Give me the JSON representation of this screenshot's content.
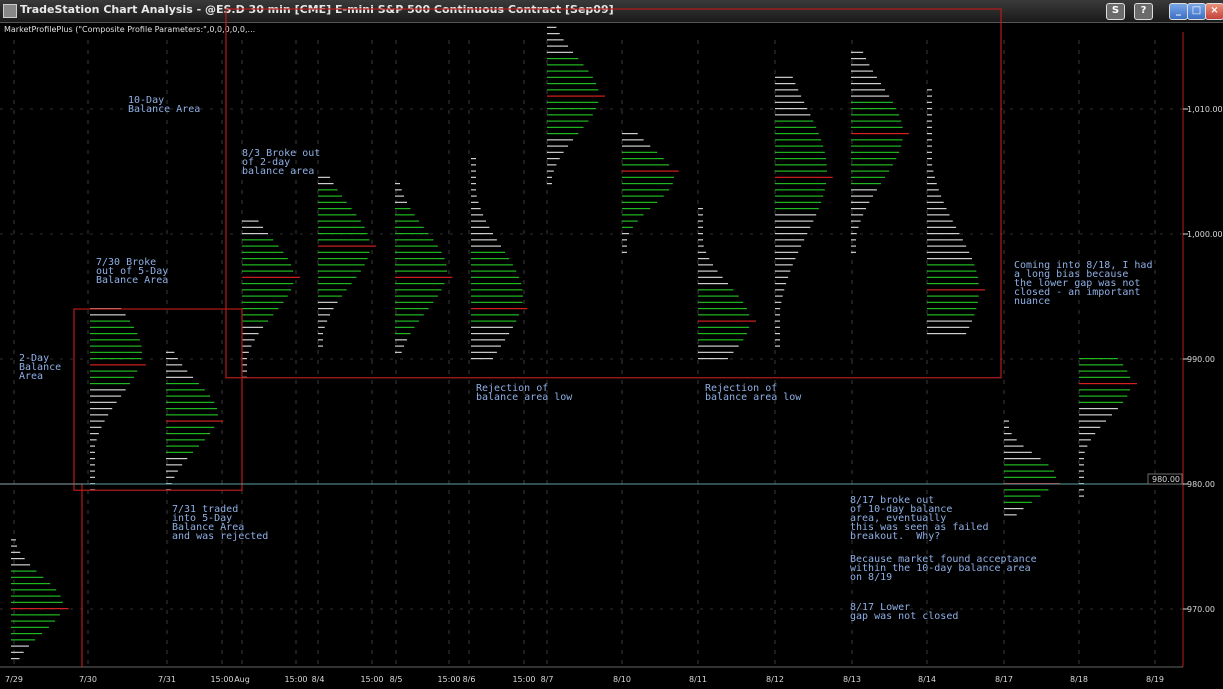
{
  "window": {
    "title": "TradeStation Chart Analysis - @ES.D 30 min [CME] E-mini S&P 500 Continuous Contract [Sep09]",
    "indicator_label": "MarketProfilePlus (\"Composite Profile Parameters:\",0,0,0,0,0,..."
  },
  "annotations": {
    "ten_day": "10-Day\nBalance Area",
    "two_day": "2-Day\nBalance\nArea",
    "break_730": "7/30 Broke\nout of 5-Day\nBalance Area",
    "traded_731": "7/31 traded\ninto 5-Day\nBalance Area\nand was rejected",
    "break_83": "8/3 Broke out\nof 2-day\nbalance area",
    "reject1": "Rejection of\nbalance area low",
    "reject2": "Rejection of\nbalance area low",
    "coming_818": "Coming into 8/18, I had\na long bias because\nthe lower gap was not\nclosed - an important\nnuance",
    "broke_817": "8/17 broke out\nof 10-day balance\narea, eventually\nthis was seen as failed\nbreakout.  Why?",
    "because": "Because market found acceptance\nwithin the 10-day balance area\non 8/19",
    "gap_817": "8/17 Lower\ngap was not closed"
  },
  "chart_data": {
    "type": "market-profile",
    "title": "@ES.D 30 min [CME] E-mini S&P 500 Continuous Contract [Sep09]",
    "y_axis": {
      "ticks": [
        "970.00",
        "980.00",
        "990.00",
        "1,000.00",
        "1,010.00"
      ],
      "tick_values": [
        970,
        980,
        990,
        1000,
        1010
      ],
      "range": [
        964,
        1019
      ]
    },
    "last_price_label": "980.00",
    "last_price": 980,
    "x_ticks": [
      "7/29",
      "7/30",
      "7/31",
      "15:00",
      "Aug",
      "15:00",
      "8/4",
      "15:00",
      "8/5",
      "15:00",
      "8/6",
      "15:00",
      "8/7",
      "8/10",
      "8/11",
      "8/12",
      "8/13",
      "8/14",
      "8/17",
      "8/18",
      "8/19"
    ],
    "profiles": [
      {
        "date": "7/29",
        "low": 966.0,
        "high": 975.5,
        "va_low": 967.5,
        "va_high": 973.0,
        "poc": 970.0,
        "dist": 970.3
      },
      {
        "date": "7/30",
        "low": 979.5,
        "high": 994.0,
        "va_low": 988.0,
        "va_high": 993.0,
        "poc": 989.5,
        "dist": 990.5
      },
      {
        "date": "7/31",
        "low": 979.5,
        "high": 990.5,
        "va_low": 982.5,
        "va_high": 988.0,
        "poc": 985.0,
        "dist": 985.5
      },
      {
        "date": "8/3",
        "low": 988.5,
        "high": 1001.0,
        "va_low": 993.0,
        "va_high": 999.5,
        "poc": 996.5,
        "dist": 996.5
      },
      {
        "date": "8/4",
        "low": 991.0,
        "high": 1004.5,
        "va_low": 995.0,
        "va_high": 1003.5,
        "poc": 999.0,
        "dist": 999.0
      },
      {
        "date": "8/5",
        "low": 990.5,
        "high": 1004.0,
        "va_low": 992.0,
        "va_high": 1002.0,
        "poc": 996.5,
        "dist": 997.0
      },
      {
        "date": "8/6",
        "low": 990.0,
        "high": 1006.0,
        "va_low": 993.0,
        "va_high": 998.5,
        "poc": 994.0,
        "dist": 995.0
      },
      {
        "date": "8/7",
        "low": 1004.0,
        "high": 1016.5,
        "va_low": 1008.0,
        "va_high": 1014.0,
        "poc": 1011.0,
        "dist": 1011.0
      },
      {
        "date": "8/10",
        "low": 998.5,
        "high": 1008.0,
        "va_low": 1000.5,
        "va_high": 1006.5,
        "poc": 1005.0,
        "dist": 1004.5
      },
      {
        "date": "8/11",
        "low": 990.0,
        "high": 1002.0,
        "va_low": 991.5,
        "va_high": 995.5,
        "poc": 993.0,
        "dist": 993.0
      },
      {
        "date": "8/12",
        "low": 991.0,
        "high": 1012.5,
        "va_low": 1002.0,
        "va_high": 1009.0,
        "poc": 1004.5,
        "dist": 1005.0
      },
      {
        "date": "8/13",
        "low": 998.5,
        "high": 1014.5,
        "va_low": 1004.0,
        "va_high": 1010.5,
        "poc": 1008.0,
        "dist": 1008.0
      },
      {
        "date": "8/14",
        "low": 992.0,
        "high": 1011.5,
        "va_low": 993.5,
        "va_high": 997.5,
        "poc": 995.5,
        "dist": 995.5
      },
      {
        "date": "8/17",
        "low": 977.5,
        "high": 985.0,
        "va_low": 978.5,
        "va_high": 981.5,
        "poc": 980.0,
        "dist": 980.5
      },
      {
        "date": "8/18",
        "low": 979.0,
        "high": 990.0,
        "va_low": 986.5,
        "va_high": 990.0,
        "poc": 988.0,
        "dist": 988.0
      }
    ],
    "balance_areas": [
      {
        "name": "10-Day Balance Area",
        "low": 988.5,
        "high": 1018.0
      },
      {
        "name": "5-Day Balance Area",
        "low": 979.5,
        "high": 994.0
      },
      {
        "name": "2-Day Balance Area",
        "low": 964.0,
        "high": 980.0
      }
    ],
    "colors": {
      "value_area": "#1fb81f",
      "range": "#cfcfcf",
      "poc": "#d42020",
      "box": "#b81c1c",
      "annotation": "#8fb0e6",
      "price_line": "#5f9ea0"
    },
    "grid": true
  }
}
